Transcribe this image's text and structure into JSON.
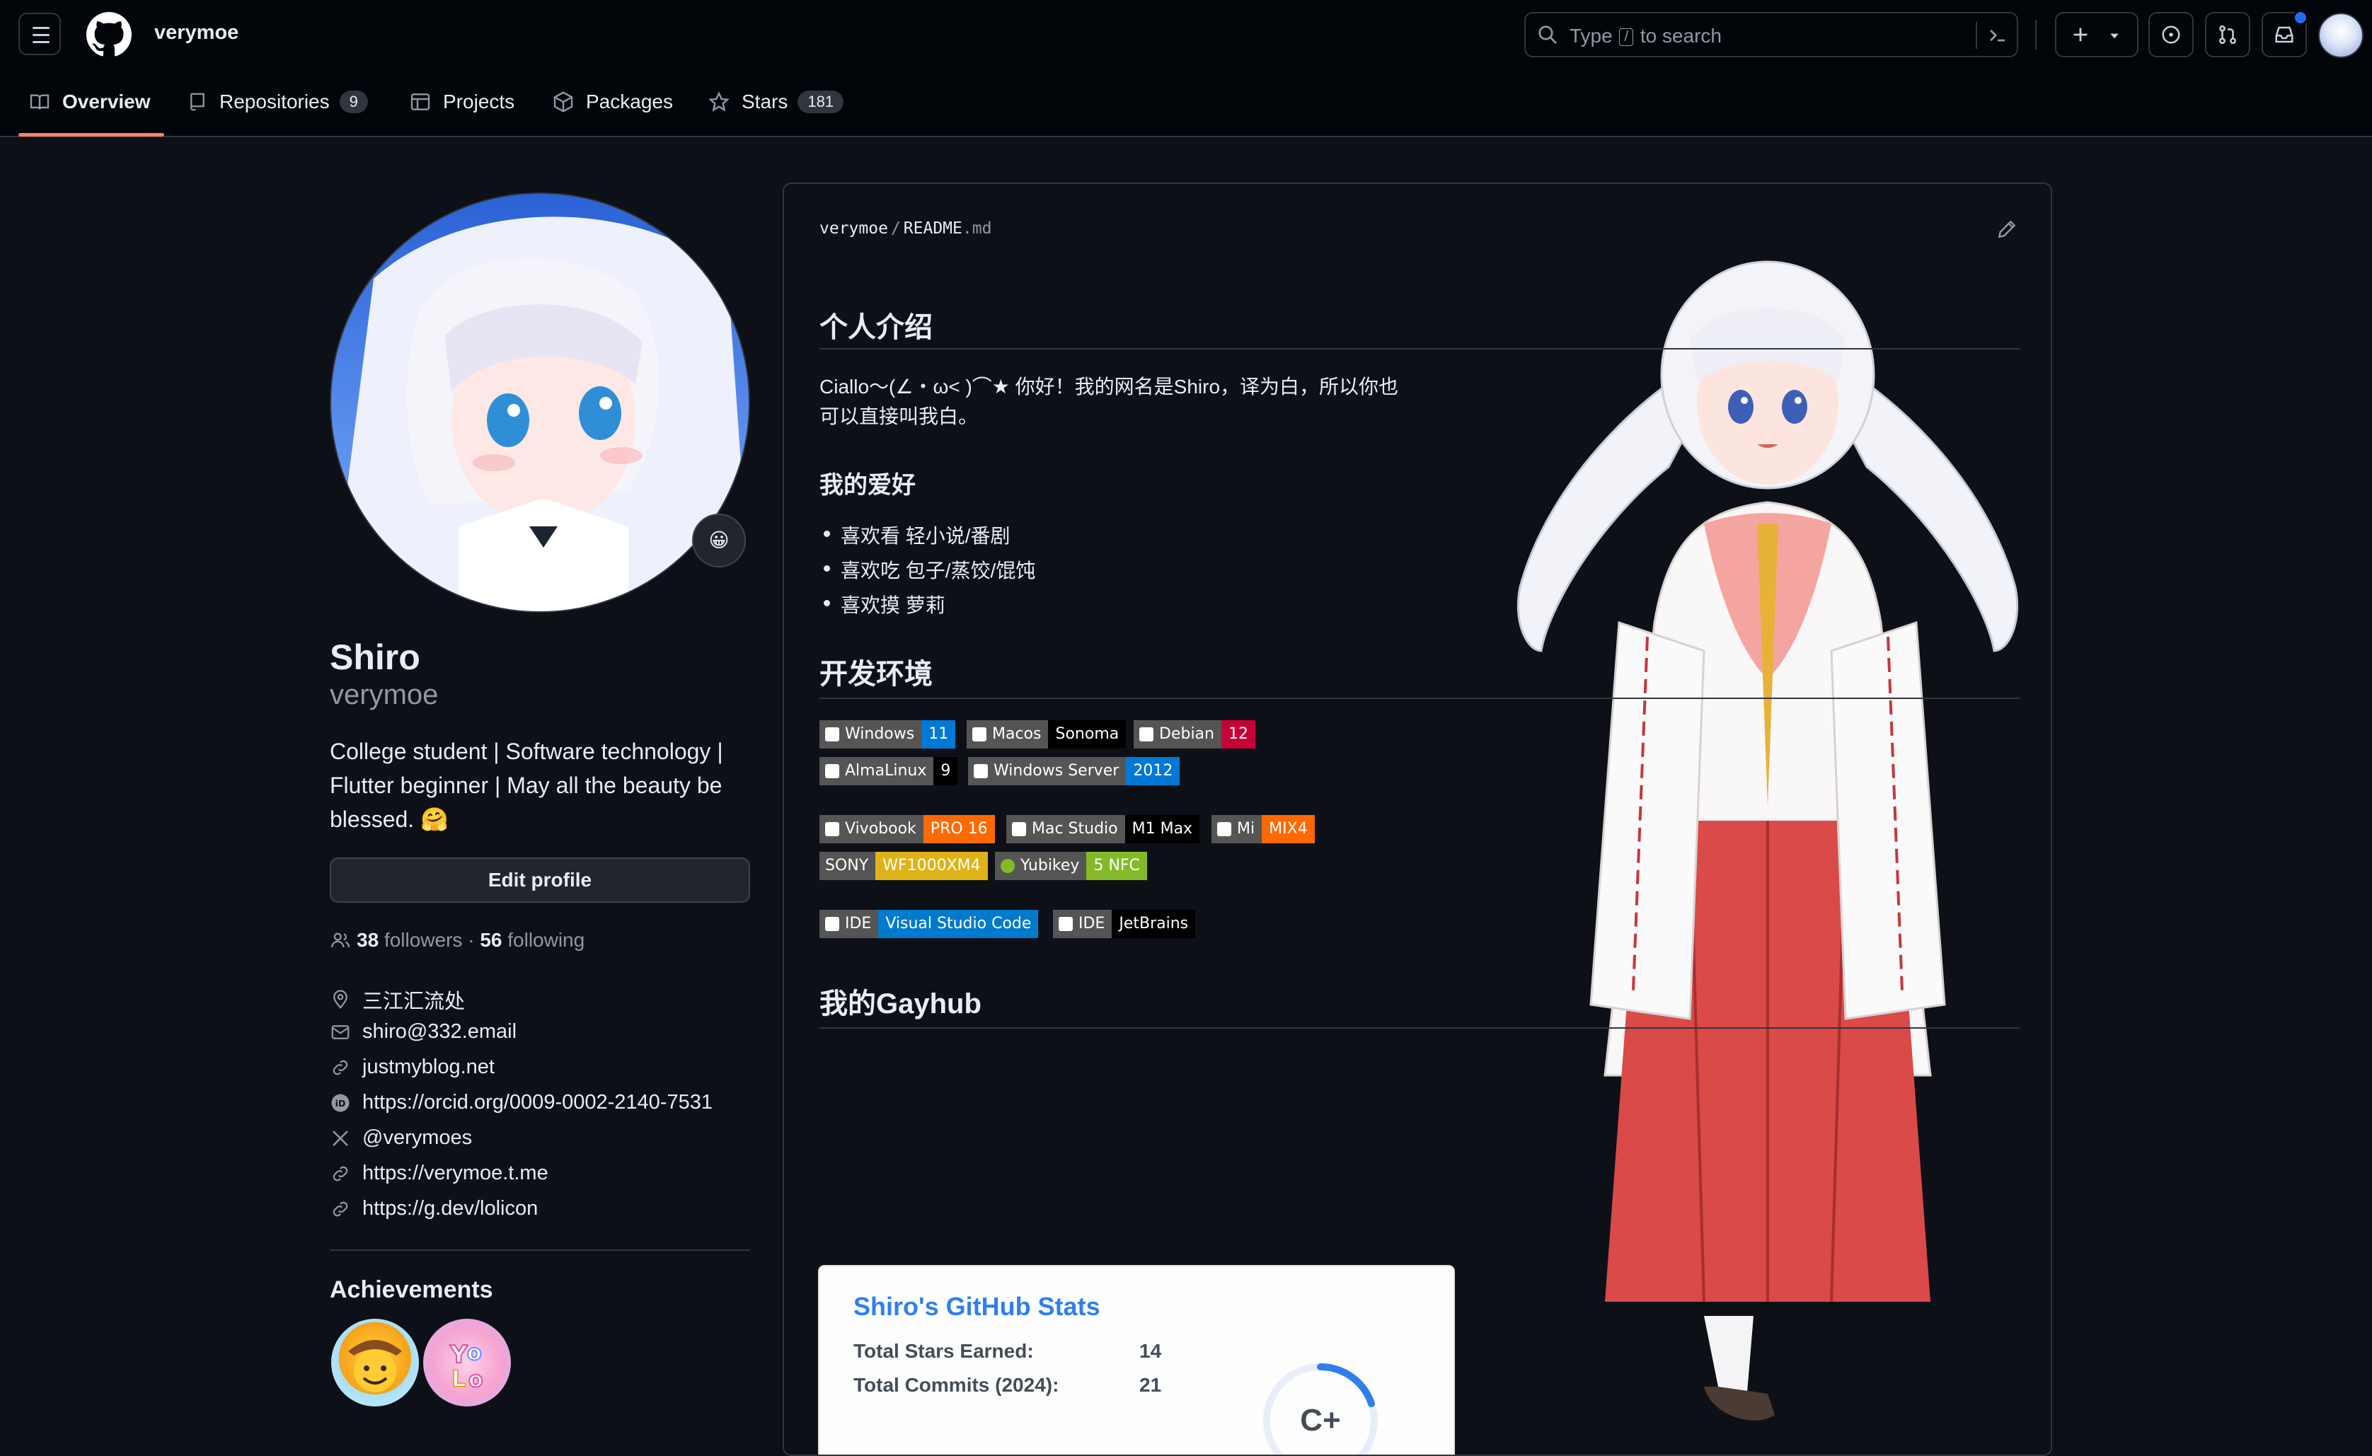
{
  "header": {
    "username": "verymoe",
    "search_prefix": "Type",
    "search_slash": "/",
    "search_suffix": "to search"
  },
  "tabs": [
    {
      "label": "Overview",
      "count": null
    },
    {
      "label": "Repositories",
      "count": "9"
    },
    {
      "label": "Projects",
      "count": null
    },
    {
      "label": "Packages",
      "count": null
    },
    {
      "label": "Stars",
      "count": "181"
    }
  ],
  "profile": {
    "name": "Shiro",
    "login": "verymoe",
    "bio": "College student | Software technology | Flutter beginner | May all the beauty be blessed. 🤗",
    "status_emoji": "😀",
    "edit_label": "Edit profile",
    "followers_count": "38",
    "followers_label": "followers",
    "sep": "·",
    "following_count": "56",
    "following_label": "following",
    "vcard": [
      {
        "icon": "location-icon",
        "text": "三江汇流处"
      },
      {
        "icon": "mail-icon",
        "text": "shiro@332.email"
      },
      {
        "icon": "link-icon",
        "text": "justmyblog.net"
      },
      {
        "icon": "orcid-icon",
        "text": "https://orcid.org/0009-0002-2140-7531"
      },
      {
        "icon": "x-icon",
        "text": "@verymoes"
      },
      {
        "icon": "link-icon",
        "text": "https://verymoe.t.me"
      },
      {
        "icon": "link-icon",
        "text": "https://g.dev/lolicon"
      }
    ],
    "achievements_title": "Achievements",
    "achievements": [
      "cowboy-achievement",
      "yolo-achievement"
    ]
  },
  "readme": {
    "owner": "verymoe",
    "sep": "/",
    "file": "README",
    "ext": ".md",
    "h_intro": "个人介绍",
    "intro_line1": "Ciallo～(∠・ω< )⌒★ 你好！我的网名是Shiro，译为白，所以你也",
    "intro_line2": "可以直接叫我白。",
    "h_hobby": "我的爱好",
    "hobbies": [
      "喜欢看 轻小说/番剧",
      "喜欢吃 包子/蒸饺/馄饨",
      "喜欢摸 萝莉"
    ],
    "h_env": "开发环境",
    "shields": [
      {
        "left": "Windows",
        "right": "11",
        "color": "#0078d6",
        "icon": "windows-icon"
      },
      {
        "left": "Macos",
        "right": "Sonoma",
        "color": "#000000",
        "icon": "apple-icon"
      },
      {
        "left": "Debian",
        "right": "12",
        "color": "#c70036",
        "icon": "debian-icon"
      },
      {
        "left": "AlmaLinux",
        "right": "9",
        "color": "#000000",
        "icon": "almalinux-icon"
      },
      {
        "left": "Windows Server",
        "right": "2012",
        "color": "#0078d6",
        "icon": "windows-icon"
      },
      {
        "left": "Vivobook",
        "right": "PRO 16",
        "color": "#ff6a00",
        "icon": "asus-icon"
      },
      {
        "left": "Mac Studio",
        "right": "M1 Max",
        "color": "#000000",
        "icon": "apple-icon"
      },
      {
        "left": "Mi",
        "right": "MIX4",
        "color": "#ff6900",
        "icon": "xiaomi-icon"
      },
      {
        "left": "SONY",
        "right": "WF1000XM4",
        "color": "#dfb317",
        "icon": ""
      },
      {
        "left": "Yubikey",
        "right": "5 NFC",
        "color": "#84ba27",
        "icon": "yubico-icon"
      },
      {
        "left": "IDE",
        "right": "Visual Studio Code",
        "color": "#007acc",
        "icon": "vscode-icon"
      },
      {
        "left": "IDE",
        "right": "JetBrains",
        "color": "#000000",
        "icon": "jetbrains-icon"
      }
    ],
    "h_gayhub": "我的Gayhub",
    "stats_title": "Shiro's GitHub Stats",
    "stats_rows": [
      {
        "label": "Total Stars Earned:",
        "value": "14"
      },
      {
        "label": "Total Commits (2024):",
        "value": "21"
      }
    ],
    "stats_rank": "C+"
  }
}
